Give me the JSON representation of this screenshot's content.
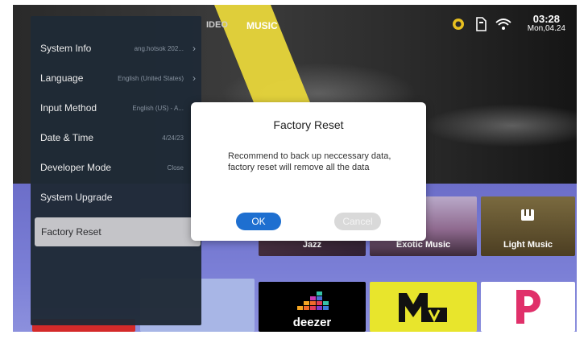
{
  "top_tabs": {
    "video": "IDEO",
    "music": "MUSIC"
  },
  "status": {
    "time": "03:28",
    "date": "Mon,04.24",
    "icons": [
      "settings-gear-icon",
      "sd-card-icon",
      "wifi-icon"
    ]
  },
  "sidebar": {
    "items": [
      {
        "label": "System Info",
        "value": "ang.hotsok 202..."
      },
      {
        "label": "Language",
        "value": "English (United States)"
      },
      {
        "label": "Input Method",
        "value": "English (US) - A..."
      },
      {
        "label": "Date & Time",
        "value": "4/24/23"
      },
      {
        "label": "Developer Mode",
        "value": "Close"
      },
      {
        "label": "System Upgrade",
        "value": ""
      },
      {
        "label": "Factory Reset",
        "value": ""
      }
    ]
  },
  "dialog": {
    "title": "Factory Reset",
    "message": "Recommend to back up neccessary data, factory reset will remove all the data",
    "ok_label": "OK",
    "cancel_label": "Cancel"
  },
  "tiles": {
    "jazz": "Jazz",
    "exotic": "Exotic Music",
    "light": "Light Music",
    "deezer": "deezer"
  },
  "colors": {
    "accent_blue": "#1e6fd0",
    "sidebar_bg": "#1f2a36",
    "purple_bg": "#7b7fd6",
    "yellow": "#e8d63a"
  }
}
